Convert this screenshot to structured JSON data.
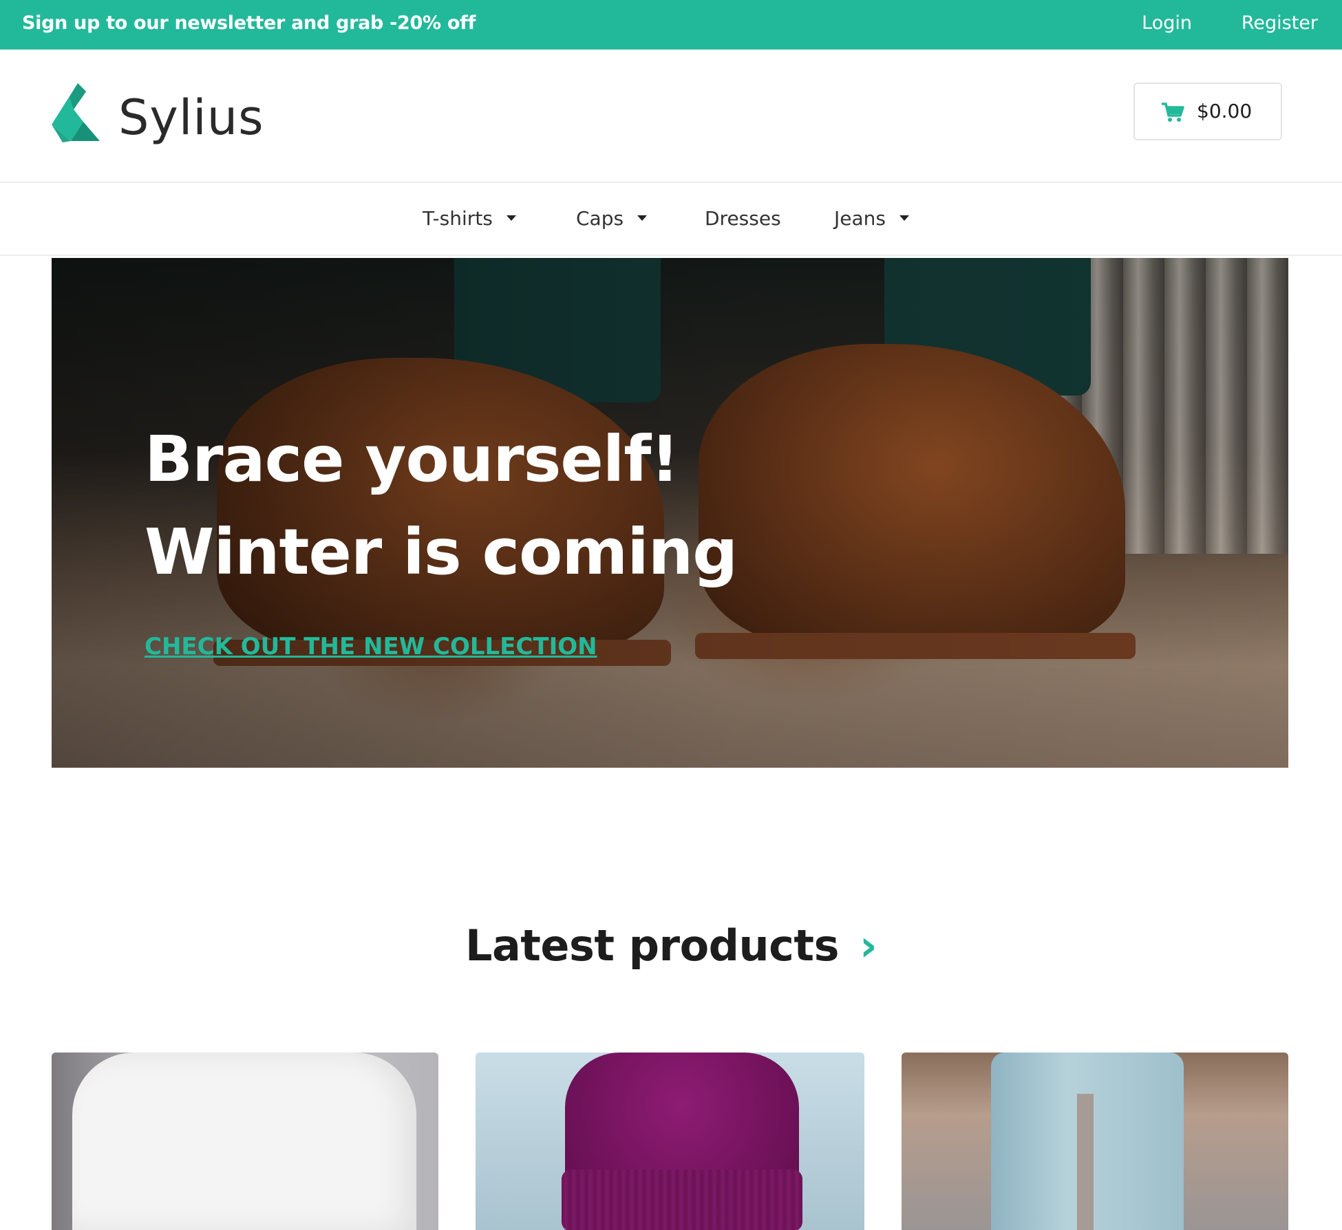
{
  "topbar": {
    "promo": "Sign up to our newsletter and grab -20% off",
    "login": "Login",
    "register": "Register",
    "color": "#22b99a"
  },
  "header": {
    "logo_text": "Sylius",
    "logo_icon": "sylius-swan-icon",
    "cart_icon": "shopping-cart-icon",
    "cart_total": "$0.00"
  },
  "nav": {
    "items": [
      {
        "label": "T-shirts",
        "has_dropdown": true
      },
      {
        "label": "Caps",
        "has_dropdown": true
      },
      {
        "label": "Dresses",
        "has_dropdown": false
      },
      {
        "label": "Jeans",
        "has_dropdown": true
      }
    ]
  },
  "hero": {
    "line1": "Brace yourself!",
    "line2": "Winter is coming",
    "cta": "CHECK OUT THE NEW COLLECTION"
  },
  "latest": {
    "title": "Latest products",
    "chevron": "›"
  },
  "colors": {
    "accent": "#22b99a",
    "text": "#1d1d1d"
  }
}
